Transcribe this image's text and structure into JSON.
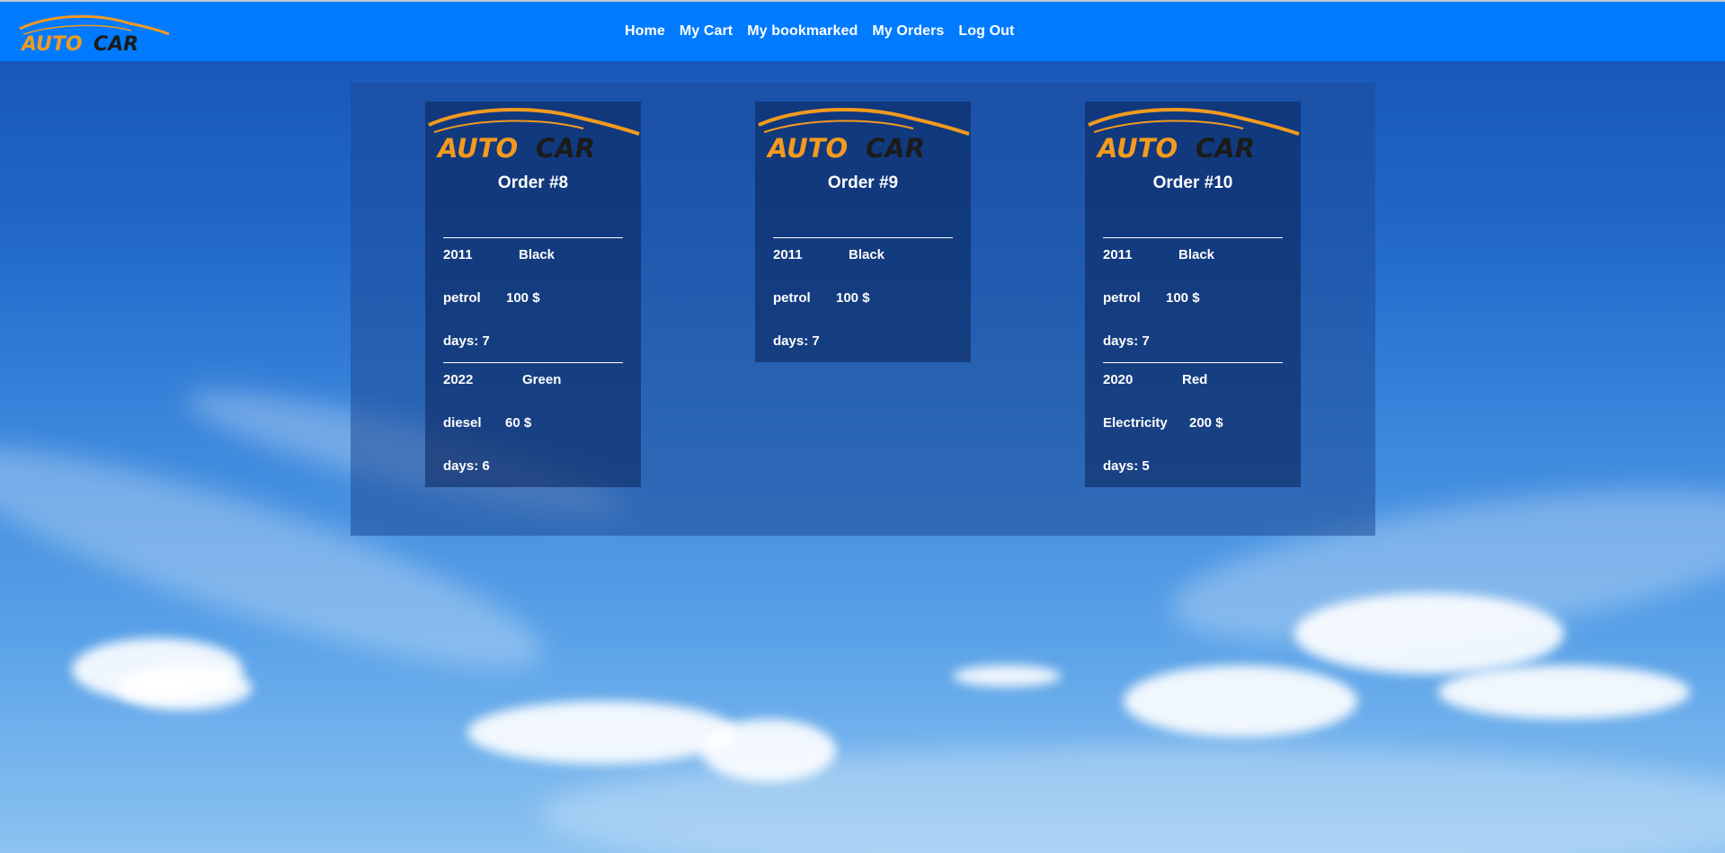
{
  "brand": {
    "logo_text_a": "AUTO",
    "logo_text_b": "CAR",
    "accent": "#f39a1f",
    "dark": "#1b1b1b"
  },
  "colors": {
    "navbar": "#007bff"
  },
  "nav": {
    "items": [
      {
        "label": "Home"
      },
      {
        "label": "My Cart"
      },
      {
        "label": "My bookmarked"
      },
      {
        "label": "My Orders"
      },
      {
        "label": "Log Out"
      }
    ]
  },
  "orders": [
    {
      "title": "Order #8",
      "items": [
        {
          "year": "2011",
          "color": "Black",
          "fuel": "petrol",
          "price": "100 $",
          "days": "days: 7"
        },
        {
          "year": "2022",
          "color": "Green",
          "fuel": "diesel",
          "price": "60 $",
          "days": "days: 6"
        }
      ]
    },
    {
      "title": "Order #9",
      "items": [
        {
          "year": "2011",
          "color": "Black",
          "fuel": "petrol",
          "price": "100 $",
          "days": "days: 7"
        }
      ]
    },
    {
      "title": "Order #10",
      "items": [
        {
          "year": "2011",
          "color": "Black",
          "fuel": "petrol",
          "price": "100 $",
          "days": "days: 7"
        },
        {
          "year": "2020",
          "color": "Red",
          "fuel": "Electricity",
          "price": "200 $",
          "days": "days: 5"
        }
      ]
    }
  ]
}
